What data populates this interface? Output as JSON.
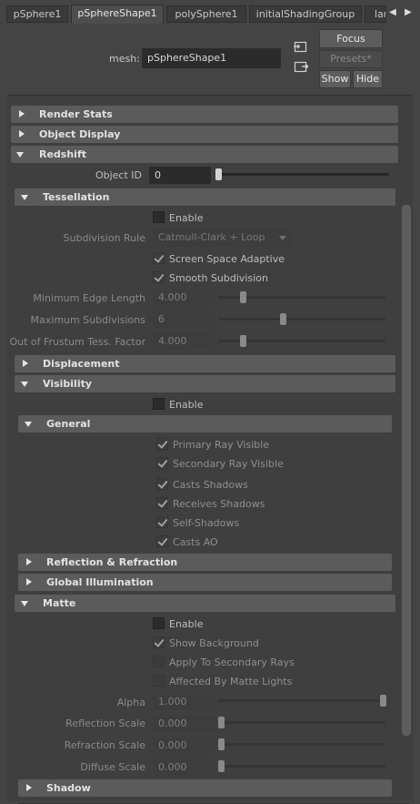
{
  "tabs": [
    "pSphere1",
    "pSphereShape1",
    "polySphere1",
    "initialShadingGroup",
    "lar"
  ],
  "tab_nav": {
    "left": "◀",
    "right": "▶"
  },
  "header": {
    "mesh_label": "mesh:",
    "mesh_value": "pSphereShape1",
    "focus": "Focus",
    "presets": "Presets*",
    "show": "Show",
    "hide": "Hide"
  },
  "sections": {
    "render_stats": "Render Stats",
    "object_display": "Object Display",
    "redshift": "Redshift",
    "tessellation": "Tessellation",
    "displacement": "Displacement",
    "visibility": "Visibility",
    "general": "General",
    "reflection_refraction": "Reflection & Refraction",
    "global_illumination": "Global Illumination",
    "matte": "Matte",
    "shadow": "Shadow"
  },
  "object_id": {
    "label": "Object ID",
    "value": "0",
    "slider_fraction": 0.0
  },
  "tessellation": {
    "enable": {
      "label": "Enable",
      "checked": false
    },
    "subdivision_rule": {
      "label": "Subdivision Rule",
      "value": "Catmull-Clark + Loop"
    },
    "screen_space_adaptive": {
      "label": "Screen Space Adaptive",
      "checked": true
    },
    "smooth_subdivision": {
      "label": "Smooth Subdivision",
      "checked": true
    },
    "min_edge_length": {
      "label": "Minimum Edge Length",
      "value": "4.000",
      "slider_fraction": 0.14
    },
    "max_subdivisions": {
      "label": "Maximum Subdivisions",
      "value": "6",
      "slider_fraction": 0.5
    },
    "out_of_frustum": {
      "label": "Out of Frustum Tess. Factor",
      "value": "4.000",
      "slider_fraction": 0.14
    }
  },
  "visibility": {
    "enable": {
      "label": "Enable",
      "checked": false
    },
    "general": {
      "primary_ray_visible": {
        "label": "Primary Ray Visible",
        "checked": true
      },
      "secondary_ray_visible": {
        "label": "Secondary Ray Visible",
        "checked": true
      },
      "casts_shadows": {
        "label": "Casts Shadows",
        "checked": true
      },
      "receives_shadows": {
        "label": "Receives Shadows",
        "checked": true
      },
      "self_shadows": {
        "label": "Self-Shadows",
        "checked": true
      },
      "casts_ao": {
        "label": "Casts AO",
        "checked": true
      }
    }
  },
  "matte": {
    "enable": {
      "label": "Enable",
      "checked": false
    },
    "show_background": {
      "label": "Show Background",
      "checked": true
    },
    "apply_to_secondary_rays": {
      "label": "Apply To Secondary Rays",
      "checked": false
    },
    "affected_by_matte_lights": {
      "label": "Affected By Matte Lights",
      "checked": false
    },
    "alpha": {
      "label": "Alpha",
      "value": "1.000",
      "slider_fraction": 1.0
    },
    "reflection_scale": {
      "label": "Reflection Scale",
      "value": "0.000",
      "slider_fraction": 0.0
    },
    "refraction_scale": {
      "label": "Refraction Scale",
      "value": "0.000",
      "slider_fraction": 0.0
    },
    "diffuse_scale": {
      "label": "Diffuse Scale",
      "value": "0.000",
      "slider_fraction": 0.0
    }
  }
}
